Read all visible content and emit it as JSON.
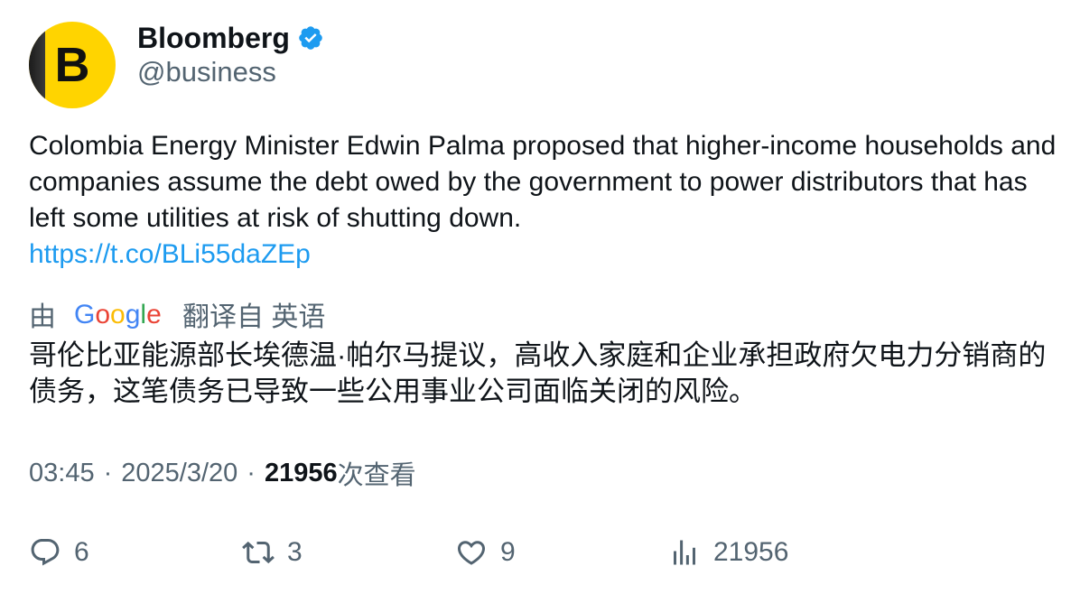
{
  "author": {
    "display_name": "Bloomberg",
    "handle": "@business",
    "avatar_letter": "B",
    "avatar_color": "#ffd400",
    "verified": true,
    "verified_icon": "verified-badge-icon",
    "verified_color": "#1d9bf0"
  },
  "tweet": {
    "text": "Colombia Energy Minister Edwin Palma proposed that higher-income households and companies assume the debt owed by the government to power distributors that has left some utilities at risk of shutting down.",
    "link": "https://t.co/BLi55daZEp"
  },
  "translation": {
    "prefix": "由",
    "provider": "Google",
    "suffix": "翻译自 英语",
    "text": "哥伦比亚能源部长埃德温·帕尔马提议，高收入家庭和企业承担政府欠电力分销商的债务，这笔债务已导致一些公用事业公司面临关闭的风险。"
  },
  "meta": {
    "time": "03:45",
    "dot": "·",
    "date": "2025/3/20",
    "views": "21956",
    "views_label": "次查看"
  },
  "actions": {
    "replies": "6",
    "retweets": "3",
    "likes": "9",
    "views": "21956"
  },
  "colors": {
    "text_primary": "#0f1419",
    "text_secondary": "#536471",
    "link": "#1d9bf0"
  }
}
